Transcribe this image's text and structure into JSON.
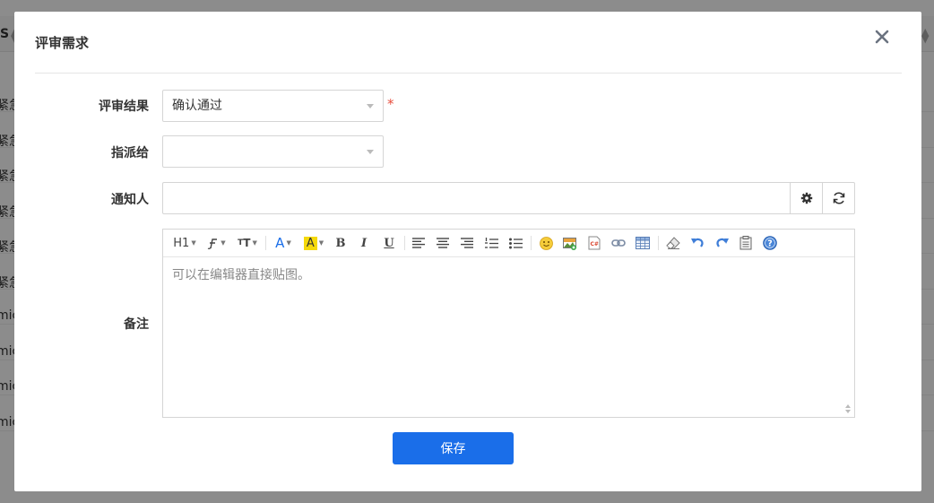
{
  "background": {
    "header_text": "S",
    "row_texts": [
      "紧急",
      "紧急",
      "紧急",
      "紧急",
      "紧急",
      "紧急",
      "mic",
      "mic",
      "mic",
      "mic"
    ]
  },
  "dialog": {
    "title": "评审需求",
    "close_icon": "close-icon",
    "fields": {
      "result": {
        "label": "评审结果",
        "value": "确认通过",
        "required_mark": "*"
      },
      "assign_to": {
        "label": "指派给",
        "value": ""
      },
      "notify": {
        "label": "通知人",
        "value": "",
        "settings_icon": "gear-icon",
        "refresh_icon": "refresh-icon"
      },
      "comment": {
        "label": "备注",
        "placeholder": "可以在编辑器直接贴图。"
      }
    },
    "toolbar": {
      "heading": "H1",
      "font_family_icon": "font-family-icon",
      "font_size": "TT",
      "font_color": "A",
      "highlight": "A",
      "bold": "B",
      "italic": "I",
      "underline": "U",
      "highlight_color": "#f5d90a",
      "font_color_value": "#1a6ee9"
    },
    "save_label": "保存"
  },
  "colors": {
    "primary": "#1a6ee9",
    "required": "#e74c3c"
  }
}
